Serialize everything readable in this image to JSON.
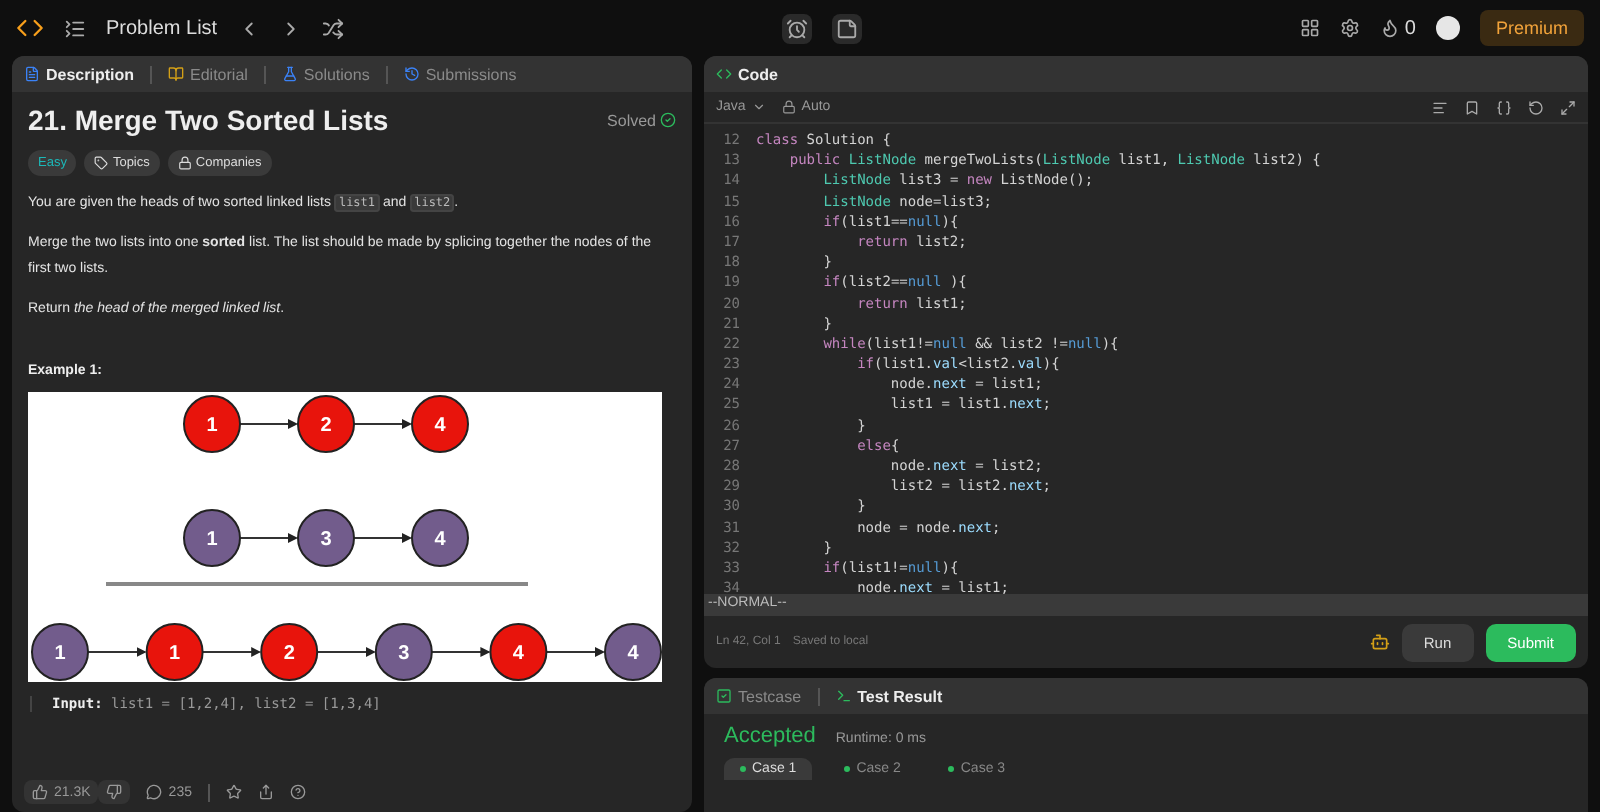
{
  "topbar": {
    "title": "Problem List",
    "streak": "0",
    "premium": "Premium"
  },
  "description": {
    "tabs": [
      {
        "label": "Description",
        "selected": true
      },
      {
        "label": "Editorial",
        "selected": false
      },
      {
        "label": "Solutions",
        "selected": false
      },
      {
        "label": "Submissions",
        "selected": false
      }
    ],
    "title": "21. Merge Two Sorted Lists",
    "status": "Solved",
    "solved": true,
    "tags": [
      {
        "label": "Easy",
        "kind": "difficulty"
      },
      {
        "label": "Topics",
        "kind": "topics"
      },
      {
        "label": "Companies",
        "kind": "companies"
      }
    ],
    "paragraphs": [
      [
        {
          "kind": "text",
          "text": "You are given the heads of two sorted linked lists "
        },
        {
          "kind": "code",
          "text": "list1"
        },
        {
          "kind": "text",
          "text": " and "
        },
        {
          "kind": "code",
          "text": "list2"
        },
        {
          "kind": "text",
          "text": "."
        }
      ],
      [
        {
          "kind": "text",
          "text": "Merge the two lists into one **sorted** list. The list should be made by splicing together the nodes of the first two lists."
        }
      ],
      [
        {
          "kind": "text",
          "text": "Return *the head of the merged linked list*."
        }
      ]
    ],
    "example": {
      "heading": "Example 1:",
      "rows": [
        {
          "nodes": [
            {
              "label": "1",
              "color": "#e8140c"
            },
            {
              "label": "2",
              "color": "#e8140c"
            },
            {
              "label": "4",
              "color": "#e8140c"
            }
          ]
        },
        {
          "nodes": [
            {
              "label": "1",
              "color": "#725c8c"
            },
            {
              "label": "3",
              "color": "#725c8c"
            },
            {
              "label": "4",
              "color": "#725c8c"
            }
          ]
        },
        {
          "nodes": [
            {
              "label": "1",
              "color": "#725c8c"
            },
            {
              "label": "1",
              "color": "#e8140c"
            },
            {
              "label": "2",
              "color": "#e8140c"
            },
            {
              "label": "3",
              "color": "#725c8c"
            },
            {
              "label": "4",
              "color": "#e8140c"
            },
            {
              "label": "4",
              "color": "#725c8c"
            }
          ]
        }
      ],
      "input_label": "Input:",
      "input_value": "list1 = [1,2,4], list2 = [1,3,4]"
    },
    "footer": {
      "likes": "21.3K",
      "comments": "235"
    }
  },
  "editor": {
    "tab": "Code",
    "language": "Java",
    "mode": "Auto",
    "lines": [
      {
        "n": "12",
        "segs": [
          {
            "kind": "kw",
            "text": "class"
          },
          {
            "kind": "p",
            "text": " Solution {"
          }
        ]
      },
      {
        "n": "13",
        "segs": [
          {
            "kind": "kw",
            "text": "    public"
          },
          {
            "kind": "ty",
            "text": " ListNode"
          },
          {
            "kind": "p",
            "text": " mergeTwoLists("
          },
          {
            "kind": "ty",
            "text": "ListNode"
          },
          {
            "kind": "p",
            "text": " list1, "
          },
          {
            "kind": "ty",
            "text": "ListNode"
          },
          {
            "kind": "p",
            "text": " list2) {"
          }
        ]
      },
      {
        "n": "14",
        "segs": [
          {
            "kind": "ty",
            "text": "        ListNode"
          },
          {
            "kind": "p",
            "text": " list3 = "
          },
          {
            "kind": "kw",
            "text": "new"
          },
          {
            "kind": "p",
            "text": " ListNode();"
          }
        ]
      },
      {
        "n": "15",
        "segs": [
          {
            "kind": "ty",
            "text": "        ListNode"
          },
          {
            "kind": "p",
            "text": " node=list3;"
          }
        ]
      },
      {
        "n": "16",
        "segs": [
          {
            "kind": "kw",
            "text": "        if"
          },
          {
            "kind": "p",
            "text": "(list1=="
          },
          {
            "kind": "lit",
            "text": "null"
          },
          {
            "kind": "p",
            "text": "){"
          }
        ]
      },
      {
        "n": "17",
        "segs": [
          {
            "kind": "kw",
            "text": "            return"
          },
          {
            "kind": "p",
            "text": " list2;"
          }
        ]
      },
      {
        "n": "18",
        "segs": [
          {
            "kind": "p",
            "text": "        }"
          }
        ]
      },
      {
        "n": "19",
        "segs": [
          {
            "kind": "kw",
            "text": "        if"
          },
          {
            "kind": "p",
            "text": "(list2=="
          },
          {
            "kind": "lit",
            "text": "null"
          },
          {
            "kind": "p",
            "text": " ){"
          }
        ]
      },
      {
        "n": "20",
        "segs": [
          {
            "kind": "kw",
            "text": "            return"
          },
          {
            "kind": "p",
            "text": " list1;"
          }
        ]
      },
      {
        "n": "21",
        "segs": [
          {
            "kind": "p",
            "text": "        }"
          }
        ]
      },
      {
        "n": "22",
        "segs": [
          {
            "kind": "kw",
            "text": "        while"
          },
          {
            "kind": "p",
            "text": "(list1!="
          },
          {
            "kind": "lit",
            "text": "null"
          },
          {
            "kind": "p",
            "text": " && list2 !="
          },
          {
            "kind": "lit",
            "text": "null"
          },
          {
            "kind": "p",
            "text": "){"
          }
        ]
      },
      {
        "n": "23",
        "segs": [
          {
            "kind": "kw",
            "text": "            if"
          },
          {
            "kind": "p",
            "text": "(list1."
          },
          {
            "kind": "fd",
            "text": "val"
          },
          {
            "kind": "p",
            "text": "<list2."
          },
          {
            "kind": "fd",
            "text": "val"
          },
          {
            "kind": "p",
            "text": "){"
          }
        ]
      },
      {
        "n": "24",
        "segs": [
          {
            "kind": "p",
            "text": "                node."
          },
          {
            "kind": "fd",
            "text": "next"
          },
          {
            "kind": "p",
            "text": " = list1;"
          }
        ]
      },
      {
        "n": "25",
        "segs": [
          {
            "kind": "p",
            "text": "                list1 = list1."
          },
          {
            "kind": "fd",
            "text": "next"
          },
          {
            "kind": "p",
            "text": ";"
          }
        ]
      },
      {
        "n": "26",
        "segs": [
          {
            "kind": "p",
            "text": "            }"
          }
        ]
      },
      {
        "n": "27",
        "segs": [
          {
            "kind": "kw",
            "text": "            else"
          },
          {
            "kind": "p",
            "text": "{"
          }
        ]
      },
      {
        "n": "28",
        "segs": [
          {
            "kind": "p",
            "text": "                node."
          },
          {
            "kind": "fd",
            "text": "next"
          },
          {
            "kind": "p",
            "text": " = list2;"
          }
        ]
      },
      {
        "n": "29",
        "segs": [
          {
            "kind": "p",
            "text": "                list2 = list2."
          },
          {
            "kind": "fd",
            "text": "next"
          },
          {
            "kind": "p",
            "text": ";"
          }
        ]
      },
      {
        "n": "30",
        "segs": [
          {
            "kind": "p",
            "text": "            }"
          }
        ]
      },
      {
        "n": "31",
        "segs": [
          {
            "kind": "p",
            "text": "            node = node."
          },
          {
            "kind": "fd",
            "text": "next"
          },
          {
            "kind": "p",
            "text": ";"
          }
        ]
      },
      {
        "n": "32",
        "segs": [
          {
            "kind": "p",
            "text": "        }"
          }
        ]
      },
      {
        "n": "33",
        "segs": [
          {
            "kind": "kw",
            "text": "        if"
          },
          {
            "kind": "p",
            "text": "(list1!="
          },
          {
            "kind": "lit",
            "text": "null"
          },
          {
            "kind": "p",
            "text": "){"
          }
        ]
      },
      {
        "n": "34",
        "segs": [
          {
            "kind": "p",
            "text": "            node."
          },
          {
            "kind": "fd",
            "text": "next"
          },
          {
            "kind": "p",
            "text": " = list1;"
          }
        ]
      }
    ],
    "vim_mode": "--NORMAL--",
    "cursor": "Ln 42, Col 1",
    "saved": "Saved to local",
    "run": "Run",
    "submit": "Submit"
  },
  "results": {
    "tabs": [
      {
        "label": "Testcase",
        "selected": false
      },
      {
        "label": "Test Result",
        "selected": true
      }
    ],
    "verdict": "Accepted",
    "runtime": "Runtime: 0 ms",
    "cases": [
      {
        "label": "Case 1",
        "selected": true
      },
      {
        "label": "Case 2",
        "selected": false
      },
      {
        "label": "Case 3",
        "selected": false
      }
    ]
  }
}
